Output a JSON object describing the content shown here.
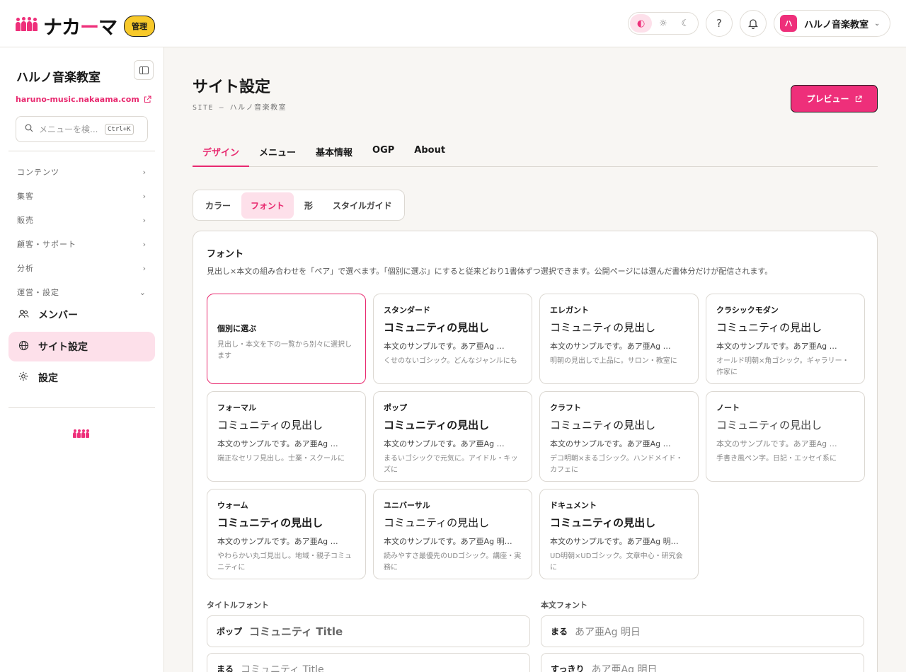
{
  "header": {
    "logo_text_1": "ナカ",
    "logo_text_2": "ー",
    "logo_text_3": "マ",
    "admin_badge": "管理",
    "account_avatar": "ハ",
    "account_name": "ハルノ音楽教室"
  },
  "sidebar": {
    "site_name": "ハルノ音楽教室",
    "site_url": "haruno-music.nakaama.com",
    "search_placeholder": "メニューを検...",
    "search_shortcut": "Ctrl+K",
    "groups": [
      {
        "label": "コンテンツ",
        "icon": "chevron-right-icon"
      },
      {
        "label": "集客",
        "icon": "chevron-right-icon"
      },
      {
        "label": "販売",
        "icon": "chevron-right-icon"
      },
      {
        "label": "顧客・サポート",
        "icon": "chevron-right-icon"
      },
      {
        "label": "分析",
        "icon": "chevron-right-icon"
      },
      {
        "label": "運営・設定",
        "icon": "chevron-down-icon"
      }
    ],
    "items": [
      {
        "label": "メンバー",
        "icon": "members-icon"
      },
      {
        "label": "サイト設定",
        "icon": "globe-icon",
        "active": true
      },
      {
        "label": "設定",
        "icon": "gear-icon"
      }
    ]
  },
  "main": {
    "title": "サイト設定",
    "breadcrumb": "SITE — ハルノ音楽教室",
    "preview_label": "プレビュー",
    "tabs": [
      "デザイン",
      "メニュー",
      "基本情報",
      "OGP",
      "About"
    ],
    "active_tab": "デザイン",
    "subtabs": [
      "カラー",
      "フォント",
      "形",
      "スタイルガイド"
    ],
    "active_subtab": "フォント"
  },
  "font_panel": {
    "title": "フォント",
    "description": "見出し×本文の組み合わせを「ペア」で選べます。「個別に選ぶ」にすると従来どおり1書体ずつ選択できます。公開ページには選んだ書体分だけが配信されます。",
    "pairs": [
      {
        "name": "個別に選ぶ",
        "heading": "",
        "body": "",
        "note": "見出し・本文を下の一覧から別々に選択します",
        "selected": true
      },
      {
        "name": "スタンダード",
        "heading": "コミュニティの見出し",
        "body": "本文のサンプルです。あア亜Ag …",
        "note": "くせのないゴシック。どんなジャンルにも"
      },
      {
        "name": "エレガント",
        "heading": "コミュニティの見出し",
        "body": "本文のサンプルです。あア亜Ag …",
        "note": "明朝の見出しで上品に。サロン・教室に"
      },
      {
        "name": "クラシックモダン",
        "heading": "コミュニティの見出し",
        "body": "本文のサンプルです。あア亜Ag …",
        "note": "オールド明朝×角ゴシック。ギャラリー・作家に"
      },
      {
        "name": "フォーマル",
        "heading": "コミュニティの見出し",
        "body": "本文のサンプルです。あア亜Ag …",
        "note": "端正なセリフ見出し。士業・スクールに"
      },
      {
        "name": "ポップ",
        "heading": "コミュニティの見出し",
        "body": "本文のサンプルです。あア亜Ag …",
        "note": "まるいゴシックで元気に。アイドル・キッズに"
      },
      {
        "name": "クラフト",
        "heading": "コミュニティの見出し",
        "body": "本文のサンプルです。あア亜Ag …",
        "note": "デコ明朝×まるゴシック。ハンドメイド・カフェに"
      },
      {
        "name": "ノート",
        "heading": "コミュニティの見出し",
        "body": "本文のサンプルです。あア亜Ag …",
        "note": "手書き風ペン字。日記・エッセイ系に"
      },
      {
        "name": "ウォーム",
        "heading": "コミュニティの見出し",
        "body": "本文のサンプルです。あア亜Ag …",
        "note": "やわらかい丸ゴ見出し。地域・親子コミュニティに"
      },
      {
        "name": "ユニバーサル",
        "heading": "コミュニティの見出し",
        "body": "本文のサンプルです。あア亜Ag 明…",
        "note": "読みやすさ最優先のUDゴシック。講座・実務に"
      },
      {
        "name": "ドキュメント",
        "heading": "コミュニティの見出し",
        "body": "本文のサンプルです。あア亜Ag 明…",
        "note": "UD明朝×UDゴシック。文章中心・研究会に"
      }
    ],
    "title_font_label": "タイトルフォント",
    "body_font_label": "本文フォント",
    "title_fonts": [
      {
        "tag": "ポップ",
        "sample": "コミュニティ Title"
      },
      {
        "tag": "まる",
        "sample": "コミュニティ Title"
      }
    ],
    "body_fonts": [
      {
        "tag": "まる",
        "sample": "あア亜Ag 明日"
      },
      {
        "tag": "すっきり",
        "sample": "あア亜Ag 明日"
      }
    ]
  }
}
